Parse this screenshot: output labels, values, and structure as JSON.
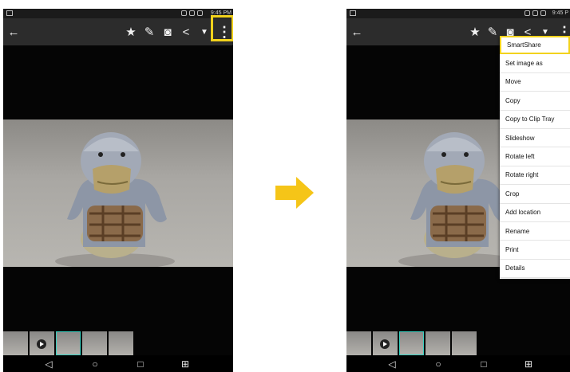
{
  "status_bar": {
    "time": "9:45 PM",
    "time_cropped": "9:45 P"
  },
  "action_bar": {
    "icons": [
      "back-arrow-icon",
      "star-icon",
      "edit-icon",
      "camera-icon",
      "share-icon",
      "delete-icon",
      "overflow-menu-icon"
    ],
    "glyphs": {
      "back": "←",
      "star": "★",
      "edit": "✎",
      "camera": "◙",
      "share": "<",
      "delete": "▼",
      "overflow": "⋮"
    }
  },
  "nav_bar": {
    "glyphs": {
      "back": "◁",
      "home": "○",
      "recent": "□",
      "dual": "⊞"
    }
  },
  "menu": {
    "items": [
      "SmartShare",
      "Set image as",
      "Move",
      "Copy",
      "Copy to Clip Tray",
      "Slideshow",
      "Rotate left",
      "Rotate right",
      "Crop",
      "Add location",
      "Rename",
      "Print",
      "Details"
    ]
  },
  "colors": {
    "highlight": "#f2d21c",
    "arrow": "#f5c518",
    "selected_thumb": "#38d0c0"
  }
}
